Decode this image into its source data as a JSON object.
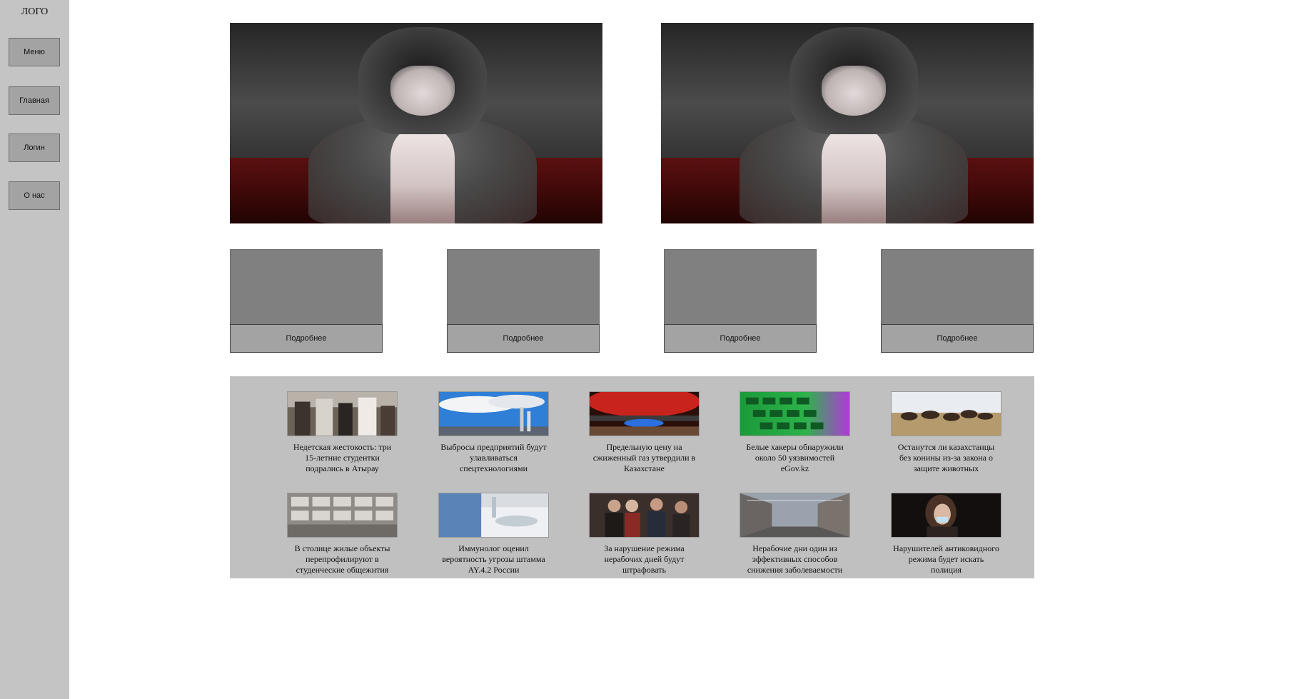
{
  "sidebar": {
    "logo": "ЛОГО",
    "items": [
      {
        "label": "Меню"
      },
      {
        "label": "Главная"
      },
      {
        "label": "Логин"
      },
      {
        "label": "О нас"
      }
    ]
  },
  "cards": [
    {
      "button_label": "Подробнее"
    },
    {
      "button_label": "Подробнее"
    },
    {
      "button_label": "Подробнее"
    },
    {
      "button_label": "Подробнее"
    }
  ],
  "news": [
    {
      "title": "Недетская жестокость: три 15-летние студентки подрались в Атырау"
    },
    {
      "title": "Выбросы предприятий будут улавливаться спецтехнологиями"
    },
    {
      "title": "Предельную цену на сжиженный газ утвердили в Казахстане"
    },
    {
      "title": "Белые хакеры обнаружили около 50 уязвимостей eGov.kz"
    },
    {
      "title": "Останутся ли казахстанцы без конины из-за закона о защите животных"
    },
    {
      "title": "В столице жилые объекты перепрофилируют в студенческие общежития"
    },
    {
      "title": "Иммунолог оценил вероятность угрозы штамма AY.4.2 России"
    },
    {
      "title": "За нарушение режима нерабочих дней будут штрафовать"
    },
    {
      "title": "Нерабочие дни один из эффективных способов снижения заболеваемости"
    },
    {
      "title": "Нарушителей антиковидного режима будет искать полиция"
    }
  ],
  "colors": {
    "sidebar_bg": "#c4c4c4",
    "button_bg": "#a3a3a3",
    "card_bg": "#808080",
    "news_panel_bg": "#c0c0c0"
  }
}
